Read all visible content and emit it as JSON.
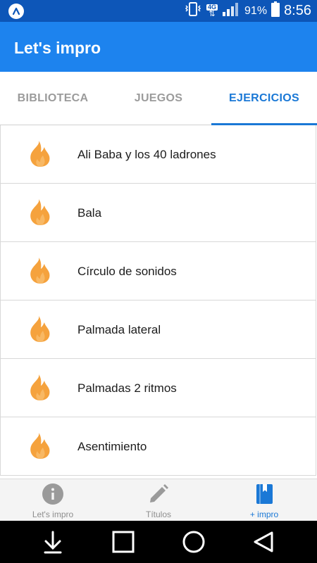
{
  "status_bar": {
    "network_label": "4G",
    "battery": "91%",
    "time": "8:56"
  },
  "app": {
    "title": "Let's impro"
  },
  "tabs": [
    {
      "label": "BIBLIOTECA",
      "active": false
    },
    {
      "label": "JUEGOS",
      "active": false
    },
    {
      "label": "EJERCICIOS",
      "active": true
    }
  ],
  "list": {
    "icon": "flame-icon",
    "icon_color": "#f5a23d",
    "items": [
      {
        "label": "Ali Baba y los 40 ladrones"
      },
      {
        "label": "Bala"
      },
      {
        "label": "Círculo de sonidos"
      },
      {
        "label": "Palmada lateral"
      },
      {
        "label": "Palmadas 2 ritmos"
      },
      {
        "label": "Asentimiento"
      }
    ]
  },
  "bottom_nav": [
    {
      "label": "Let's impro",
      "icon": "info-icon",
      "active": false
    },
    {
      "label": "Títulos",
      "icon": "pencil-icon",
      "active": false
    },
    {
      "label": "+ impro",
      "icon": "book-icon",
      "active": true
    }
  ],
  "colors": {
    "status_bar": "#0d56b8",
    "app_bar": "#1d83ee",
    "accent": "#1a78d6",
    "inactive": "#9b9b9b"
  }
}
